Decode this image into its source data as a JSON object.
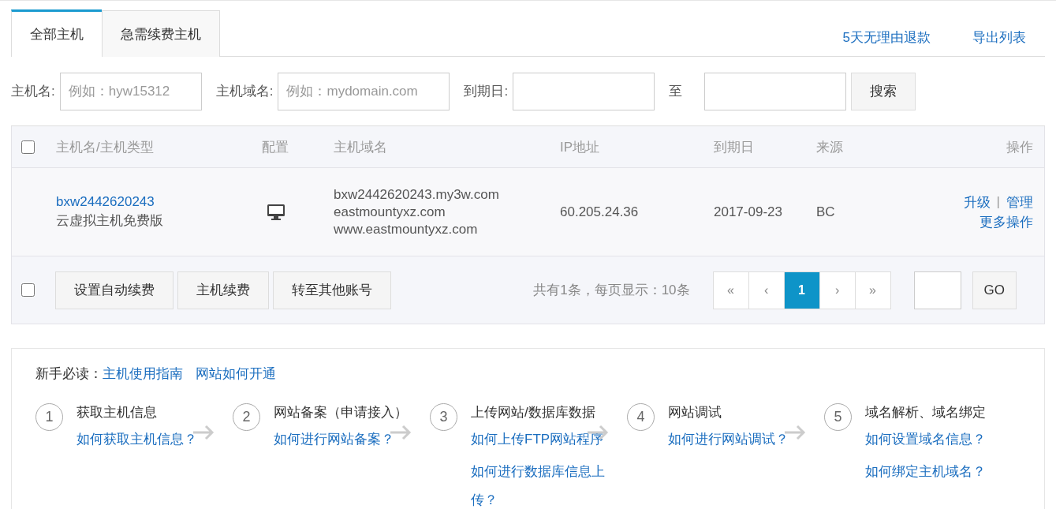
{
  "tabs": [
    {
      "label": "全部主机",
      "selected": true
    },
    {
      "label": "急需续费主机",
      "selected": false
    }
  ],
  "top_links": [
    "5天无理由退款",
    "导出列表"
  ],
  "filters": {
    "host_name": {
      "label": "主机名:",
      "placeholder": "例如：hyw15312"
    },
    "host_domain": {
      "label": "主机域名:",
      "placeholder": "例如：mydomain.com"
    },
    "expiry": {
      "label": "到期日:",
      "separator": "至"
    },
    "search_button": "搜索"
  },
  "table": {
    "select_all": {
      "checked": false
    },
    "columns": [
      "主机名/主机类型",
      "配置",
      "主机域名",
      "IP地址",
      "到期日",
      "来源",
      "操作"
    ],
    "rows": [
      {
        "host_name": "bxw2442620243",
        "host_type": "云虚拟主机免费版",
        "domains": [
          "bxw2442620243.my3w.com",
          "eastmountyxz.com",
          "www.eastmountyxz.com"
        ],
        "ip": "60.205.24.36",
        "expiry": "2017-09-23",
        "source": "BC",
        "actions": [
          "升级",
          "管理",
          "更多操作"
        ],
        "action_separator": "|"
      }
    ],
    "footer": {
      "select_all": {
        "checked": false
      },
      "buttons": [
        "设置自动续费",
        "主机续费",
        "转至其他账号"
      ],
      "summary": "共有1条，每页显示：10条",
      "pager": [
        {
          "label": "«",
          "selected": false
        },
        {
          "label": "‹",
          "selected": false
        },
        {
          "label": "1",
          "selected": true
        },
        {
          "label": "›",
          "selected": false
        },
        {
          "label": "»",
          "selected": false
        }
      ],
      "go_button": "GO"
    }
  },
  "guide": {
    "label": "新手必读：",
    "links": [
      "主机使用指南",
      "网站如何开通"
    ],
    "steps": [
      {
        "number": "1",
        "title": "获取主机信息",
        "links": [
          "如何获取主机信息？"
        ]
      },
      {
        "number": "2",
        "title": "网站备案（申请接入）",
        "links": [
          "如何进行网站备案？"
        ]
      },
      {
        "number": "3",
        "title": "上传网站/数据库数据",
        "links": [
          "如何上传FTP网站程序",
          "如何进行数据库信息上传？"
        ]
      },
      {
        "number": "4",
        "title": "网站调试",
        "links": [
          "如何进行网站调试？"
        ]
      },
      {
        "number": "5",
        "title": "域名解析、域名绑定",
        "links": [
          "如何设置域名信息？",
          "如何绑定主机域名？"
        ]
      }
    ]
  }
}
